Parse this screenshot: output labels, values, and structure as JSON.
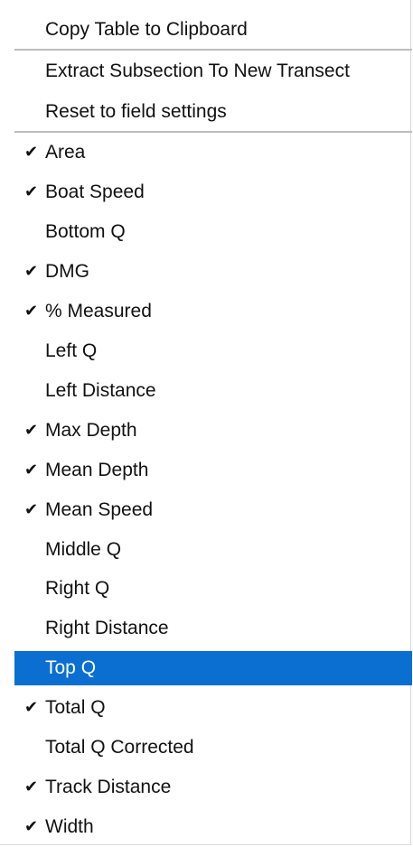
{
  "menu": {
    "actions": [
      {
        "label": "Copy Table to Clipboard"
      },
      {
        "label": "Extract Subsection To New Transect"
      },
      {
        "label": "Reset to field settings"
      }
    ],
    "columns": [
      {
        "label": "Area",
        "checked": true,
        "highlighted": false
      },
      {
        "label": "Boat Speed",
        "checked": true,
        "highlighted": false
      },
      {
        "label": "Bottom Q",
        "checked": false,
        "highlighted": false
      },
      {
        "label": "DMG",
        "checked": true,
        "highlighted": false
      },
      {
        "label": "% Measured",
        "checked": true,
        "highlighted": false
      },
      {
        "label": "Left Q",
        "checked": false,
        "highlighted": false
      },
      {
        "label": "Left Distance",
        "checked": false,
        "highlighted": false
      },
      {
        "label": "Max Depth",
        "checked": true,
        "highlighted": false
      },
      {
        "label": "Mean Depth",
        "checked": true,
        "highlighted": false
      },
      {
        "label": "Mean Speed",
        "checked": true,
        "highlighted": false
      },
      {
        "label": "Middle Q",
        "checked": false,
        "highlighted": false
      },
      {
        "label": "Right Q",
        "checked": false,
        "highlighted": false
      },
      {
        "label": "Right Distance",
        "checked": false,
        "highlighted": false
      },
      {
        "label": "Top Q",
        "checked": false,
        "highlighted": true
      },
      {
        "label": "Total Q",
        "checked": true,
        "highlighted": false
      },
      {
        "label": "Total Q Corrected",
        "checked": false,
        "highlighted": false
      },
      {
        "label": "Track Distance",
        "checked": true,
        "highlighted": false
      },
      {
        "label": "Width",
        "checked": true,
        "highlighted": false
      }
    ],
    "check_glyph": "✔",
    "check_icon": "checkmark-icon",
    "highlight_color": "#0a6fd1"
  }
}
